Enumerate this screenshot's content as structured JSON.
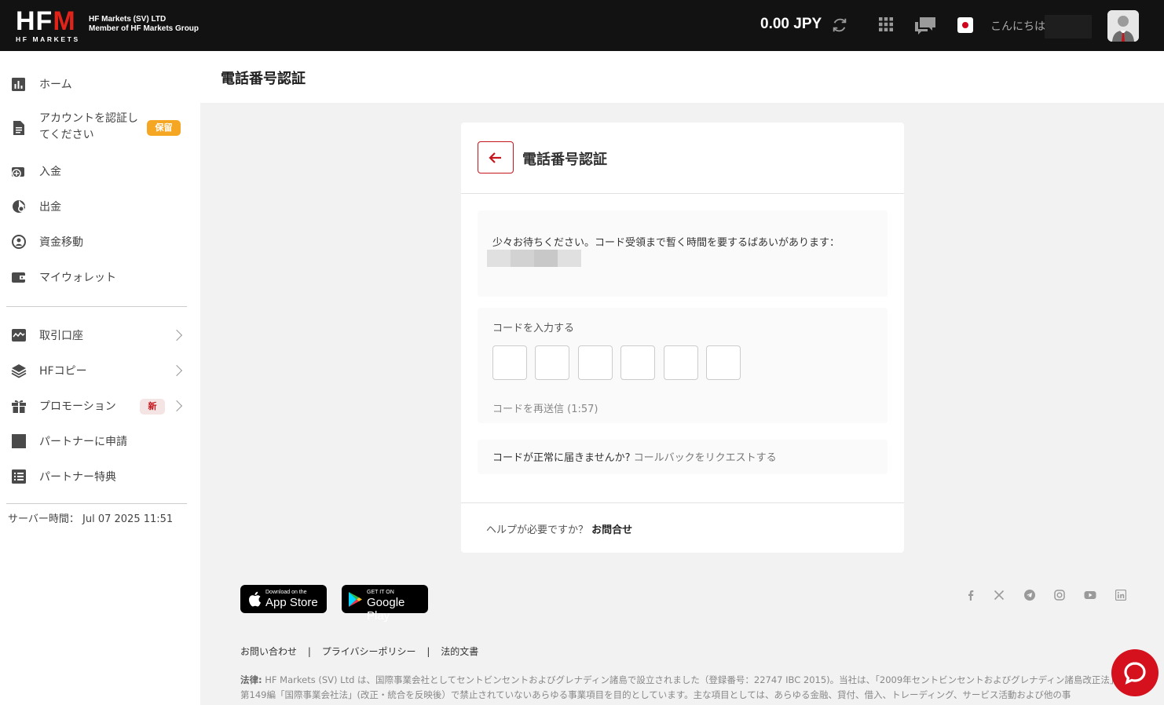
{
  "header": {
    "logo_text": "HFM",
    "logo_sub": "HF MARKETS",
    "company_line1": "HF Markets (SV) LTD",
    "company_line2": "Member of HF Markets Group",
    "balance": "0.00 JPY",
    "greeting": "こんにちは"
  },
  "sidebar": {
    "items": [
      {
        "label": "ホーム",
        "icon": "bar-chart-icon"
      },
      {
        "label_line1": "アカウントを認証し",
        "label_line2": "てください",
        "badge": "保留",
        "icon": "document-icon"
      },
      {
        "label": "入金",
        "icon": "deposit-icon"
      },
      {
        "label": "出金",
        "icon": "withdraw-icon"
      },
      {
        "label": "資金移動",
        "icon": "transfer-icon"
      },
      {
        "label": "マイウォレット",
        "icon": "wallet-icon"
      },
      {
        "label": "取引口座",
        "icon": "trading-chart-icon"
      },
      {
        "label": "HFコピー",
        "icon": "layers-icon"
      },
      {
        "label": "プロモーション",
        "badge": "新",
        "icon": "gift-icon"
      },
      {
        "label": "パートナーに申請",
        "icon": "square-icon"
      },
      {
        "label": "パートナー特典",
        "icon": "list-icon"
      }
    ],
    "server_time_label": "サーバー時間：",
    "server_time_value": "Jul 07 2025 11:51"
  },
  "page": {
    "title": "電話番号認証"
  },
  "card": {
    "title": "電話番号認証",
    "wait_text": "少々お待ちください。コード受領まで暫く時間を要するばあいがあります：",
    "code_label": "コードを入力する",
    "resend_text": "コードを再送信 (1:57)",
    "nocode_text": "コードが正常に届きませんか?",
    "callback_link": "コールバックをリクエストする",
    "help_text": "ヘルプが必要ですか？",
    "help_link": "お問合せ"
  },
  "footer": {
    "appstore_small": "Download on the",
    "appstore_big": "App Store",
    "googleplay_small": "GET IT ON",
    "googleplay_big": "Google Play",
    "links": [
      "お問い合わせ",
      "プライバシーポリシー",
      "法的文書"
    ],
    "link_separator": "|",
    "legal_label": "法律:",
    "legal_text": "HF Markets (SV) Ltd は、国際事業会社としてセントビンセントおよびグレナディン諸島で設立されました（登録番号：22747 IBC 2015)。当社は、「2009年セントビンセントおよびグレナディン諸島改正法」第149編「国際事業会社法」(改正・統合を反映後）で禁止されていないあらゆる事業項目を目的としています。主な項目としては、あらゆる金融、貸付、借入、トレーディング、サービス活動および他の事",
    "social": [
      "facebook-icon",
      "x-icon",
      "telegram-icon",
      "instagram-icon",
      "youtube-icon",
      "linkedin-icon"
    ]
  },
  "colors": {
    "brand_red": "#c4161c",
    "topbar": "#121212",
    "badge_hold": "#f5a623"
  }
}
